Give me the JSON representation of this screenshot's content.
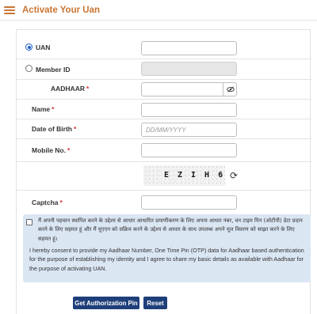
{
  "header": {
    "title": "Activate Your Uan"
  },
  "form": {
    "uan": {
      "label": "UAN",
      "value": ""
    },
    "member_id": {
      "label": "Member ID",
      "value": ""
    },
    "aadhaar": {
      "label": "AADHAAR",
      "required": "*",
      "value": "",
      "toggle_icon": "eye-slash-icon"
    },
    "name": {
      "label": "Name",
      "required": "*",
      "value": ""
    },
    "dob": {
      "label": "Date of Birth",
      "required": "*",
      "placeholder": "DD/MM/YYYY",
      "value": ""
    },
    "mobile": {
      "label": "Mobile No.",
      "required": "*",
      "value": ""
    },
    "captcha": {
      "label": "Captcha",
      "required": "*",
      "image_text": "EZIH6",
      "value": "",
      "refresh_icon": "refresh-icon"
    }
  },
  "consent": {
    "hindi": "मैं अपनी पहचान स्थापित करने के उद्देश्य से आधार आधारित प्रमाणीकरण के लिए अपना आधार नंबर, वन टाइम पिन (ओटीपी) डेटा प्रदान करने के लिए सहमत हूं और मैं यूएएन को सक्रिय करने के उद्देश्य से आधार के साथ उपलब्ध अपने मूल विवरण को साझा करने के लिए सहमत हूं।",
    "english": "I hereby consent to provide my Aadhaar Number, One Time Pin (OTP) data for Aadhaar based authentication for the purpose of establishing my identity and I agree to share my basic details as available with Aadhaar for the purpose of activating UAN."
  },
  "buttons": {
    "get_pin": "Get Authorization Pin",
    "reset": "Reset"
  },
  "colors": {
    "accent": "#c87533",
    "button": "#1f3f7a",
    "consent_bg": "#dbe6f3",
    "required": "#d32f2f"
  }
}
